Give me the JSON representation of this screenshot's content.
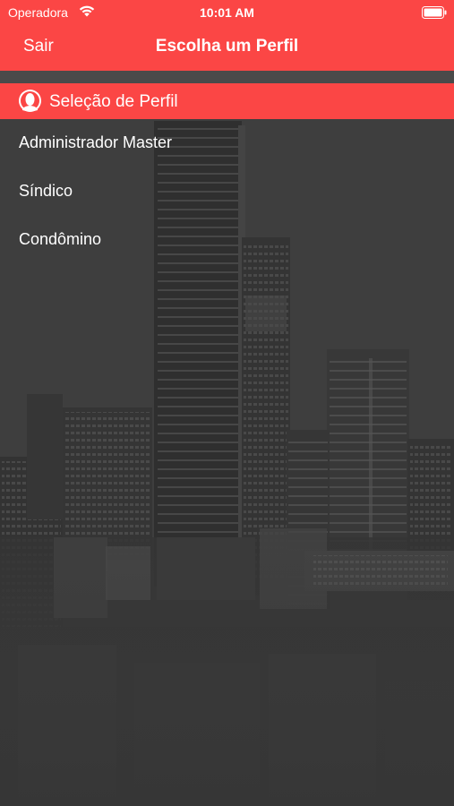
{
  "status_bar": {
    "carrier": "Operadora",
    "time": "10:01 AM",
    "wifi_icon": "wifi-icon",
    "battery_icon": "battery-icon"
  },
  "nav": {
    "back_label": "Sair",
    "title": "Escolha um Perfil"
  },
  "section": {
    "icon": "user-profile-icon",
    "label": "Seleção de Perfil"
  },
  "profiles": [
    {
      "label": "Administrador Master"
    },
    {
      "label": "Síndico"
    },
    {
      "label": "Condômino"
    }
  ],
  "colors": {
    "accent": "#fb4645",
    "background": "#3d3d3d",
    "text": "#ffffff"
  }
}
